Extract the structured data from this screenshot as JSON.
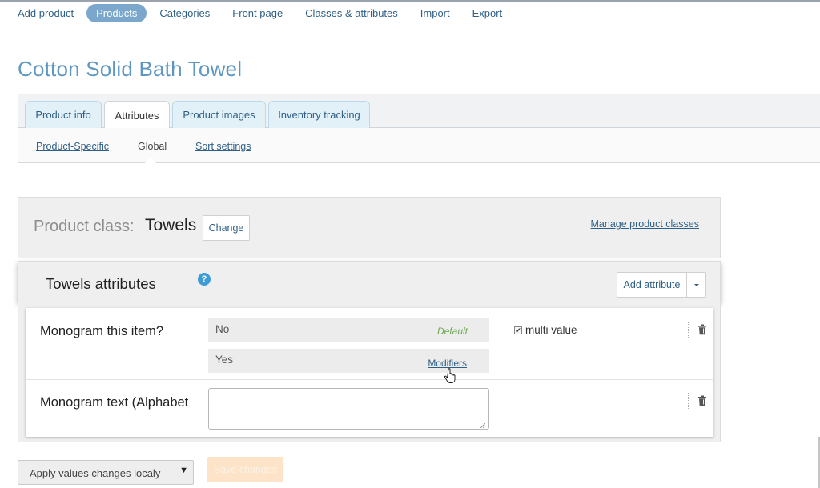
{
  "topnav": {
    "items": [
      {
        "label": "Add product",
        "active": false
      },
      {
        "label": "Products",
        "active": true
      },
      {
        "label": "Categories",
        "active": false
      },
      {
        "label": "Front page",
        "active": false
      },
      {
        "label": "Classes & attributes",
        "active": false
      },
      {
        "label": "Import",
        "active": false
      },
      {
        "label": "Export",
        "active": false
      }
    ]
  },
  "page": {
    "title": "Cotton Solid Bath Towel"
  },
  "tabs": [
    {
      "label": "Product info"
    },
    {
      "label": "Attributes",
      "active": true
    },
    {
      "label": "Product images"
    },
    {
      "label": "Inventory tracking"
    }
  ],
  "subtabs": [
    {
      "label": "Product-Specific"
    },
    {
      "label": "Global",
      "active": true
    },
    {
      "label": "Sort settings"
    }
  ],
  "product_class": {
    "label": "Product class:",
    "value": "Towels",
    "change_button": "Change",
    "manage_link": "Manage product classes"
  },
  "attributes_panel": {
    "title": "Towels attributes",
    "help_icon": "question-icon",
    "add_button": "Add attribute"
  },
  "attributes": [
    {
      "name": "Monogram this item?",
      "values": [
        {
          "label": "No",
          "tag": "Default"
        },
        {
          "label": "Yes",
          "link": "Modifiers"
        }
      ],
      "multi_value_label": "multi value",
      "multi_value_checked": true
    },
    {
      "name": "Monogram text (Alphabet",
      "input_value": ""
    }
  ],
  "bottom": {
    "select_value": "Apply values changes localy",
    "save_button": "Save changes"
  },
  "colors": {
    "accent": "#7ba7cc",
    "title": "#5d97c2",
    "link": "#2f5f86",
    "default_tag": "#6aa84f",
    "save_disabled": "#fde4c8"
  }
}
